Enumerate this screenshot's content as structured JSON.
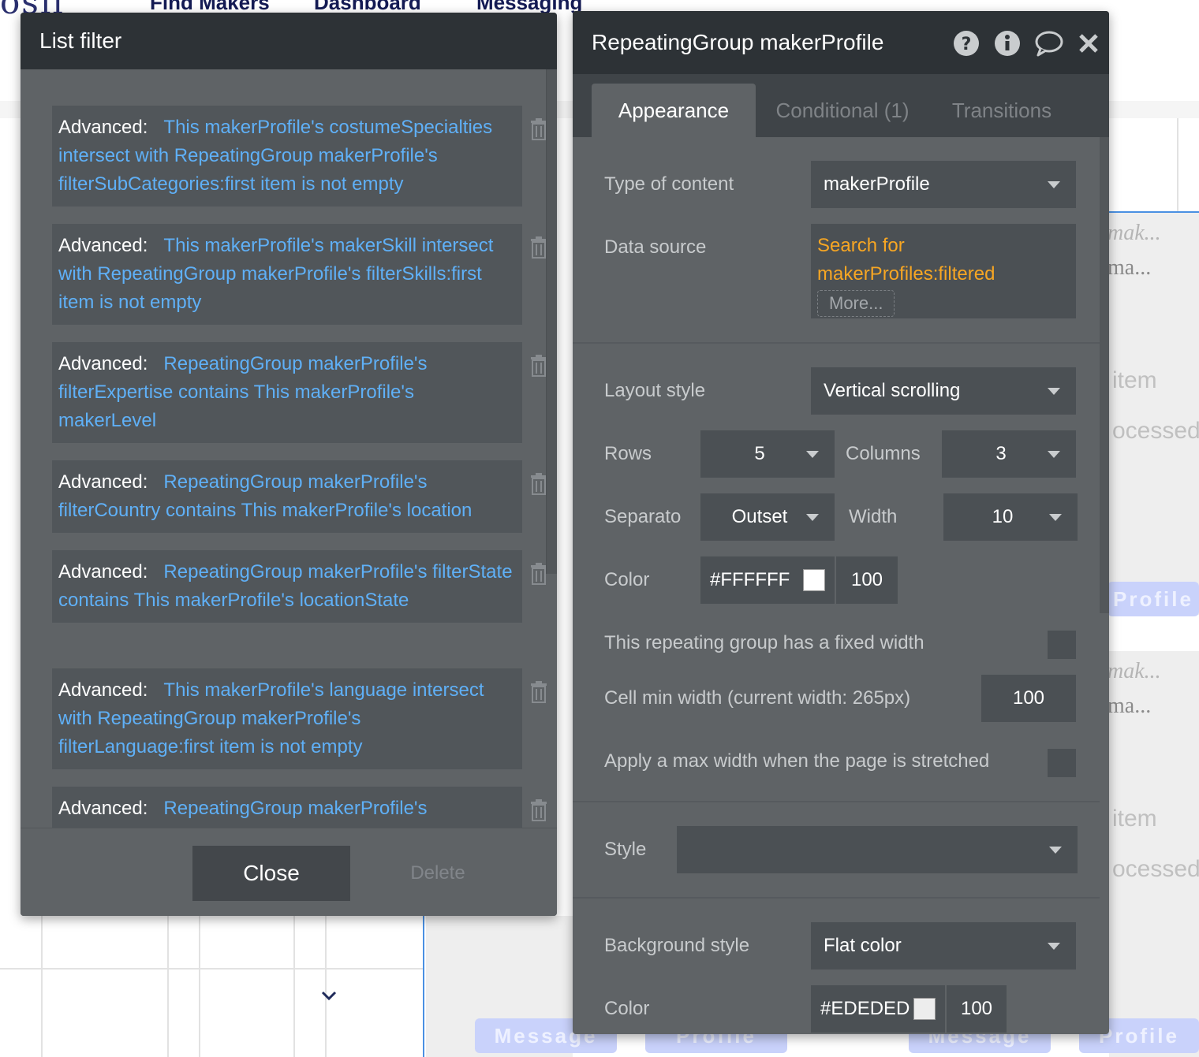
{
  "background": {
    "logo": "osii",
    "nav": [
      "Find Makers",
      "Dashboard",
      "Messaging"
    ],
    "fragments": {
      "mak": "mak...",
      "ma": "ma...",
      "item": "item",
      "processed": "ocessed",
      "message_btn": "Message",
      "profile_btn": "Profile"
    }
  },
  "list_filter": {
    "title": "List filter",
    "items": [
      {
        "label": "Advanced:",
        "expr": "This makerProfile's costumeSpecialties intersect with RepeatingGroup makerProfile's filterSubCategories:first item is not empty"
      },
      {
        "label": "Advanced:",
        "expr": "This makerProfile's makerSkill intersect with RepeatingGroup makerProfile's filterSkills:first item is not empty"
      },
      {
        "label": "Advanced:",
        "expr": "RepeatingGroup makerProfile's filterExpertise contains This makerProfile's makerLevel"
      },
      {
        "label": "Advanced:",
        "expr": "RepeatingGroup makerProfile's filterCountry contains This makerProfile's location"
      },
      {
        "label": "Advanced:",
        "expr": "RepeatingGroup makerProfile's filterState contains This makerProfile's locationState"
      },
      {
        "label": "Advanced:",
        "expr": "This makerProfile's language intersect with RepeatingGroup makerProfile's filterLanguage:first item is not empty"
      },
      {
        "label": "Advanced:",
        "expr": "RepeatingGroup makerProfile's"
      }
    ],
    "close_label": "Close",
    "delete_label": "Delete"
  },
  "property_editor": {
    "title": "RepeatingGroup makerProfile",
    "tabs": [
      {
        "label": "Appearance",
        "active": true
      },
      {
        "label": "Conditional (1)",
        "active": false
      },
      {
        "label": "Transitions",
        "active": false
      }
    ],
    "type_of_content": {
      "label": "Type of content",
      "value": "makerProfile"
    },
    "data_source": {
      "label": "Data source",
      "line1": "Search for",
      "line2": "makerProfiles:filtered",
      "more": "More..."
    },
    "layout_style": {
      "label": "Layout style",
      "value": "Vertical scrolling"
    },
    "rows": {
      "label": "Rows",
      "value": "5"
    },
    "columns": {
      "label": "Columns",
      "value": "3"
    },
    "separator": {
      "label": "Separato",
      "value": "Outset"
    },
    "sep_width": {
      "label": "Width",
      "value": "10"
    },
    "sep_color": {
      "label": "Color",
      "hex": "#FFFFFF",
      "opacity": "100"
    },
    "fixed_width": {
      "label": "This repeating group has a fixed width"
    },
    "cell_min_width": {
      "label": "Cell min width (current width: 265px)",
      "value": "100"
    },
    "max_width": {
      "label": "Apply a max width when the page is stretched"
    },
    "style": {
      "label": "Style",
      "value": ""
    },
    "background_style": {
      "label": "Background style",
      "value": "Flat color"
    },
    "bg_color": {
      "label": "Color",
      "hex": "#EDEDED",
      "opacity": "100"
    }
  },
  "colors": {
    "panel": "#5f6366",
    "header": "#2d3236",
    "expression": "#5fb0f7",
    "dynamic": "#f7a623"
  }
}
